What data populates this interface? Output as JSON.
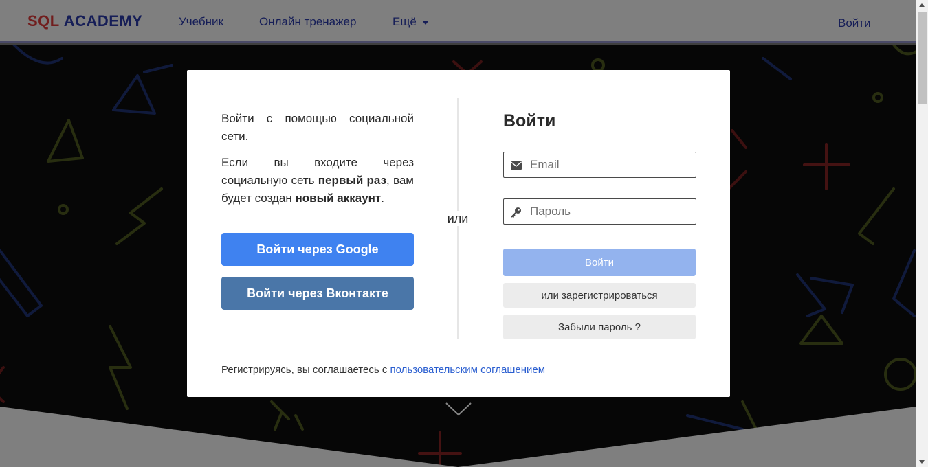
{
  "header": {
    "logo_sql": "SQL",
    "logo_academy": "ACADEMY",
    "nav": {
      "tutorial": "Учебник",
      "trainer": "Онлайн тренажер",
      "more": "Ещё"
    },
    "login_link": "Войти"
  },
  "modal": {
    "social_intro": "Войти с помощью социальной сети.",
    "social_note_part1": "Если вы входите через социальную сеть ",
    "social_note_bold1": "первый раз",
    "social_note_part2": ", вам будет создан ",
    "social_note_bold2": "новый аккаунт",
    "social_note_part3": ".",
    "google_button": "Войти через Google",
    "vk_button": "Войти через Вконтакте",
    "or_label": "или",
    "login_title": "Войти",
    "email_placeholder": "Email",
    "password_placeholder": "Пароль",
    "submit_button": "Войти",
    "register_button": "или зарегистрироваться",
    "forgot_button": "Забыли пароль ?",
    "agreement_text": "Регистрируясь, вы соглашаетесь с ",
    "agreement_link": "пользовательским соглашением"
  },
  "icons": {
    "email": "envelope-icon",
    "password": "key-icon",
    "more": "caret-down-icon",
    "scroll_hint": "chevron-down-icon"
  },
  "colors": {
    "brand_red": "#d93a3a",
    "brand_blue": "#2b3aa8",
    "google": "#3f82f0",
    "vk": "#4a76a8",
    "submit_disabled": "#93b3ee"
  }
}
